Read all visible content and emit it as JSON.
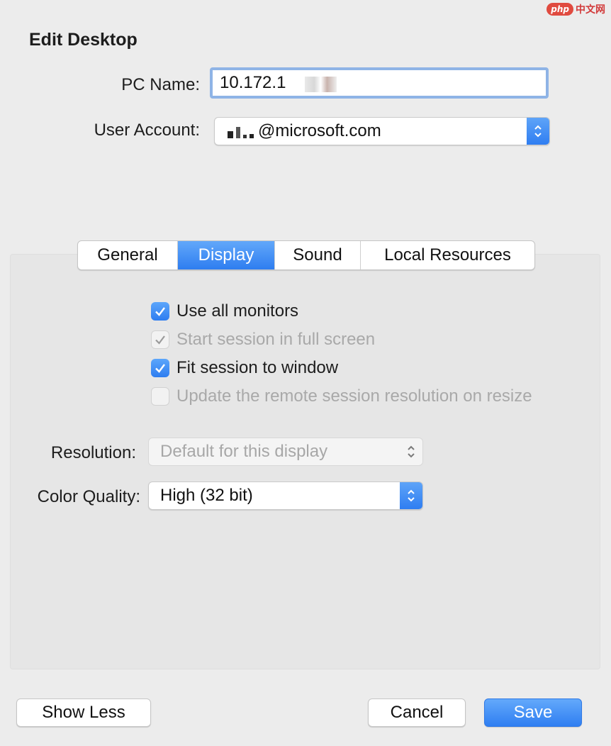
{
  "watermark": {
    "badge": "php",
    "text": "中文网"
  },
  "dialog": {
    "title": "Edit Desktop"
  },
  "pc_name": {
    "label": "PC Name:",
    "value": "10.172.1"
  },
  "user_account": {
    "label": "User Account:",
    "value": "@microsoft.com"
  },
  "tabs": [
    {
      "label": "General",
      "active": false
    },
    {
      "label": "Display",
      "active": true
    },
    {
      "label": "Sound",
      "active": false
    },
    {
      "label": "Local Resources",
      "active": false
    }
  ],
  "display": {
    "checkboxes": [
      {
        "label": "Use all monitors",
        "checked": true,
        "enabled": true
      },
      {
        "label": "Start session in full screen",
        "checked": true,
        "enabled": false
      },
      {
        "label": "Fit session to window",
        "checked": true,
        "enabled": true
      },
      {
        "label": "Update the remote session resolution on resize",
        "checked": false,
        "enabled": false
      }
    ],
    "resolution": {
      "label": "Resolution:",
      "value": "Default for this display"
    },
    "color_quality": {
      "label": "Color Quality:",
      "value": "High (32 bit)"
    }
  },
  "buttons": {
    "show_less": "Show Less",
    "cancel": "Cancel",
    "save": "Save"
  },
  "colors": {
    "accent": "#2f7ef1",
    "background": "#ececec",
    "panel": "#e6e6e6"
  }
}
